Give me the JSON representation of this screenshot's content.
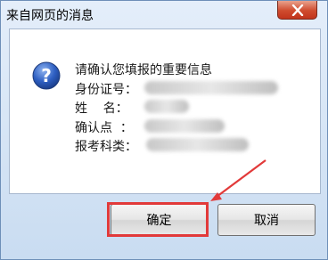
{
  "window": {
    "title": "来自网页的消息"
  },
  "icon": "question-icon",
  "message": {
    "heading": "请确认您填报的重要信息",
    "fields": [
      {
        "label": "身份证号："
      },
      {
        "label": "姓    名："
      },
      {
        "label": "确认点  ："
      },
      {
        "label": "报考科类："
      }
    ]
  },
  "buttons": {
    "ok": "确定",
    "cancel": "取消"
  },
  "colors": {
    "highlight": "#e23a3a",
    "close_button": "#c8402a"
  }
}
